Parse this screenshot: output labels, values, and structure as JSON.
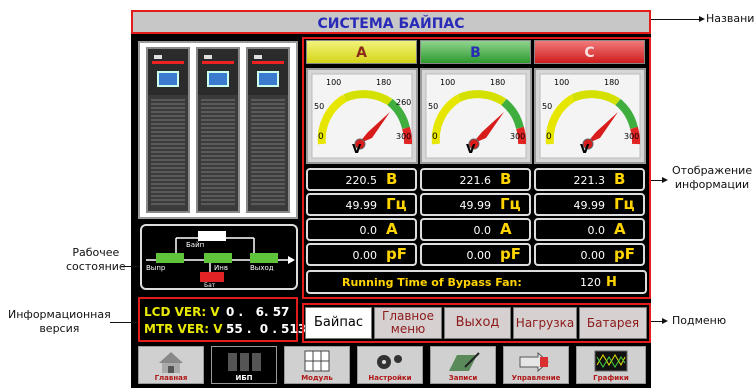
{
  "title": "СИСТЕМА БАЙПАС",
  "annotations": {
    "name": "Название",
    "info_display": [
      "Отображение",
      "информации"
    ],
    "working_state": [
      "Рабочее",
      "состояние"
    ],
    "info_version": [
      "Информационная",
      "версия"
    ],
    "submenu": "Подменю"
  },
  "status_diagram": {
    "bypass": "Байп",
    "rectifier": "Выпр",
    "inverter": "Инв",
    "output": "Выход",
    "battery": "Бат"
  },
  "version": {
    "lcd_label": "LCD VER: V",
    "lcd_value": "0 .   6. 57",
    "mtr_label": "MTR VER: V",
    "mtr_value": "55 .  0 . 513"
  },
  "phases": [
    {
      "name": "A",
      "color": "#d9d926",
      "scale": [
        "0",
        "50",
        "100",
        "180",
        "260",
        "300"
      ],
      "unit": "V",
      "voltage": "220.5",
      "frequency": "49.99",
      "current": "0.0",
      "pf": "0.00"
    },
    {
      "name": "B",
      "color": "#3fae3f",
      "scale": [
        "0",
        "50",
        "100",
        "180",
        "260",
        "300"
      ],
      "unit": "V",
      "voltage": "221.6",
      "frequency": "49.99",
      "current": "0.0",
      "pf": "0.00"
    },
    {
      "name": "C",
      "color": "#e02424",
      "scale": [
        "0",
        "50",
        "100",
        "180",
        "260",
        "300"
      ],
      "unit": "V",
      "voltage": "221.3",
      "frequency": "49.99",
      "current": "0.0",
      "pf": "0.00"
    }
  ],
  "units": {
    "voltage": "В",
    "frequency": "Гц",
    "current": "А",
    "pf": "pF"
  },
  "fan": {
    "label": "Running Time of Bypass Fan:",
    "value": "120",
    "unit": "H"
  },
  "submenu": [
    {
      "label": "Байпас",
      "active": true
    },
    {
      "label": "Главное меню",
      "active": false
    },
    {
      "label": "Выход",
      "active": false
    },
    {
      "label": "Нагрузка",
      "active": false
    },
    {
      "label": "Батарея",
      "active": false
    }
  ],
  "nav": [
    {
      "label": "Главная",
      "icon": "home-icon",
      "active": false
    },
    {
      "label": "ИБП",
      "icon": "ups-icon",
      "active": true
    },
    {
      "label": "Модуль",
      "icon": "module-icon",
      "active": false
    },
    {
      "label": "Настройки",
      "icon": "settings-icon",
      "active": false
    },
    {
      "label": "Записи",
      "icon": "records-icon",
      "active": false
    },
    {
      "label": "Управление",
      "icon": "control-icon",
      "active": false
    },
    {
      "label": "Графики",
      "icon": "chart-icon",
      "active": false
    }
  ]
}
